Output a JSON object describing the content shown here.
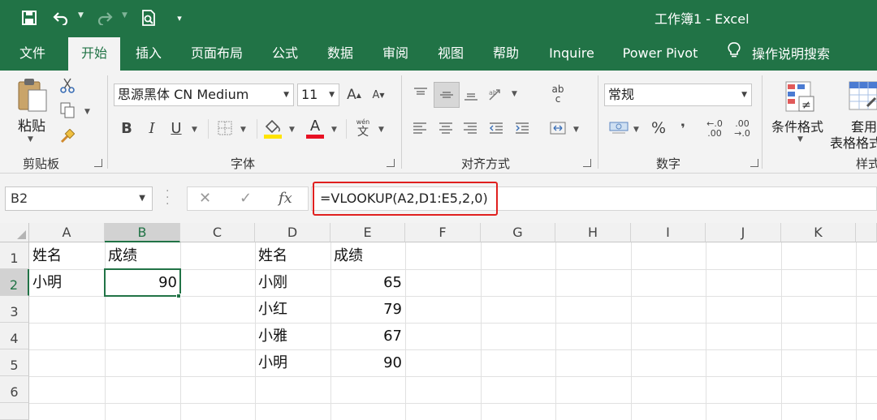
{
  "window": {
    "title": "工作簿1  -  Excel"
  },
  "tabs": [
    {
      "label": "文件"
    },
    {
      "label": "开始",
      "active": true
    },
    {
      "label": "插入"
    },
    {
      "label": "页面布局"
    },
    {
      "label": "公式"
    },
    {
      "label": "数据"
    },
    {
      "label": "审阅"
    },
    {
      "label": "视图"
    },
    {
      "label": "帮助"
    },
    {
      "label": "Inquire"
    },
    {
      "label": "Power Pivot"
    }
  ],
  "tell_me": "操作说明搜索",
  "ribbon": {
    "clipboard": {
      "paste_label": "粘贴",
      "group_label": "剪贴板"
    },
    "font": {
      "font_name": "思源黑体 CN Medium",
      "font_size": "11",
      "bold": "B",
      "italic": "I",
      "underline": "U",
      "font_color_glyph": "A",
      "increase_font": "A",
      "decrease_font": "A",
      "phonetic_top": "wén",
      "phonetic_bottom": "文",
      "group_label": "字体"
    },
    "alignment": {
      "group_label": "对齐方式",
      "wrap_glyph": "ab",
      "wrap_glyph2": "c"
    },
    "number": {
      "format": "常规",
      "percent": "%",
      "comma": "❜",
      "inc_decimal_top": "←.0",
      "inc_decimal_bottom": ".00",
      "dec_decimal_top": ".00",
      "dec_decimal_bottom": "→.0",
      "group_label": "数字"
    },
    "styles": {
      "conditional_format": "条件格式",
      "format_table_top": "套用",
      "format_table_bottom": "表格格式",
      "group_label": "样式"
    }
  },
  "formula_bar": {
    "name_box": "B2",
    "cancel_glyph": "✕",
    "enter_glyph": "✓",
    "fx_glyph": "fx",
    "formula": "=VLOOKUP(A2,D1:E5,2,0)"
  },
  "columns": [
    "A",
    "B",
    "C",
    "D",
    "E",
    "F",
    "G",
    "H",
    "I",
    "J",
    "K"
  ],
  "rows": [
    "1",
    "2",
    "3",
    "4",
    "5",
    "6"
  ],
  "active_cell": "B2",
  "cells": {
    "A1": "姓名",
    "B1": "成绩",
    "A2": "小明",
    "B2": "90",
    "D1": "姓名",
    "E1": "成绩",
    "D2": "小刚",
    "E2": "65",
    "D3": "小红",
    "E3": "79",
    "D4": "小雅",
    "E4": "67",
    "D5": "小明",
    "E5": "90"
  },
  "colors": {
    "excel_green": "#217346",
    "highlight_red": "#e0201f",
    "fill_yellow": "#ffe400",
    "font_red": "#e81123"
  }
}
